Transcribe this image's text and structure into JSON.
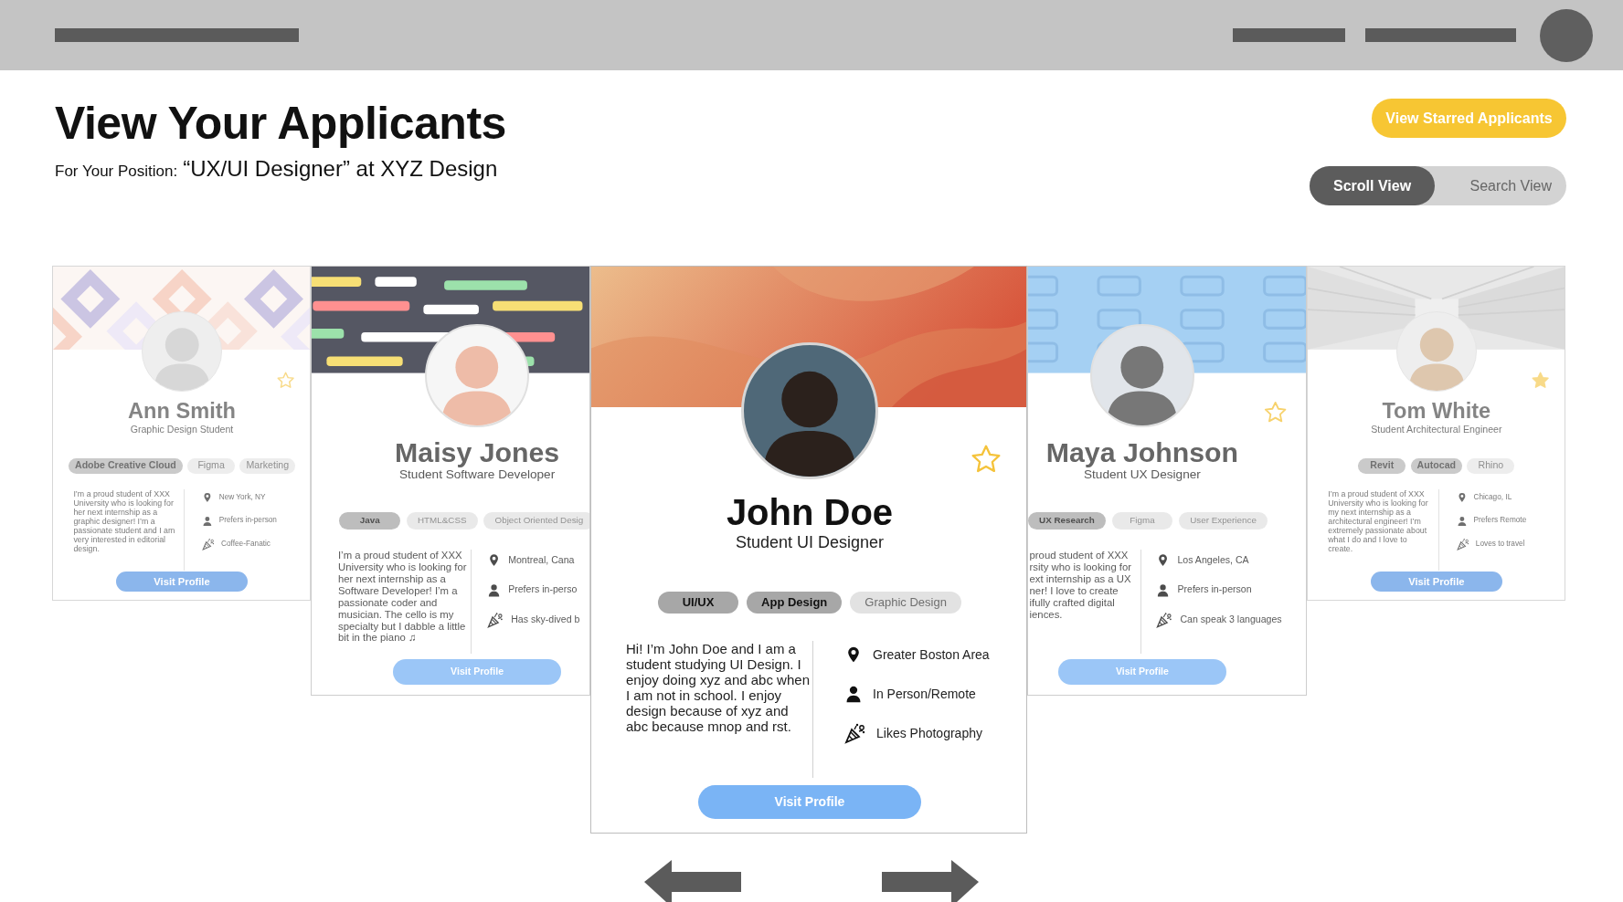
{
  "page": {
    "title": "View Your Applicants",
    "position_label": "For Your Position:",
    "position": "“UX/UI Designer” at XYZ Design"
  },
  "starred_button": "View Starred Applicants",
  "view_toggle": [
    {
      "label": "Scroll View",
      "selected": true
    },
    {
      "label": "Search View",
      "selected": false
    }
  ],
  "cards": [
    {
      "name": "Ann Smith",
      "title": "Graphic Design Student",
      "selected": false,
      "starred": false,
      "tags": [
        {
          "label": "Adobe Creative Cloud",
          "highlighted": true
        },
        {
          "label": "Figma",
          "highlighted": false
        },
        {
          "label": "Marketing",
          "highlighted": false
        }
      ],
      "bio_lines": [
        "I’m a proud student of XXX",
        "University who is looking for",
        "her next internship as a",
        "graphic designer! I’m a",
        "passionate student and I am",
        "very interested in editorial",
        "design."
      ],
      "details": [
        {
          "kind": "location",
          "text": "New York, NY"
        },
        {
          "kind": "work_mode",
          "text": "Prefers in-person"
        },
        {
          "kind": "fun_fact",
          "text": "Coffee-Fanatic"
        }
      ],
      "button": "Visit Profile"
    },
    {
      "name": "Maisy Jones",
      "title": "Student Software Developer",
      "selected": false,
      "tags": [
        {
          "label": "Java",
          "highlighted": true
        },
        {
          "label": "HTML&CSS",
          "highlighted": false
        },
        {
          "label": "Object Oriented Desig",
          "highlighted": false
        }
      ],
      "bio_lines": [
        "I’m a proud student of XXX",
        "University who is looking for",
        "her next internship as a",
        "Software Developer! I’m a",
        "passionate coder and",
        "musician. The cello is my",
        "specialty but I dabble a little",
        "bit in the piano ♫"
      ],
      "details": [
        {
          "kind": "location",
          "text": "Montreal, Cana"
        },
        {
          "kind": "work_mode",
          "text": "Prefers in-perso"
        },
        {
          "kind": "fun_fact",
          "text": "Has sky-dived b"
        }
      ],
      "button": "Visit Profile"
    },
    {
      "name": "John Doe",
      "title": "Student UI Designer",
      "selected": true,
      "starred": false,
      "tags": [
        {
          "label": "UI/UX",
          "highlighted": true
        },
        {
          "label": "App Design",
          "highlighted": true
        },
        {
          "label": "Graphic Design",
          "highlighted": false
        }
      ],
      "bio_lines": [
        "Hi! I’m John Doe and I am a",
        "student studying UI Design. I",
        "enjoy doing xyz and abc when",
        "I am not in school. I enjoy",
        "design because of xyz and",
        "abc because mnop and rst."
      ],
      "details": [
        {
          "kind": "location",
          "text": "Greater Boston Area"
        },
        {
          "kind": "work_mode",
          "text": "In Person/Remote"
        },
        {
          "kind": "fun_fact",
          "text": "Likes Photography"
        }
      ],
      "button": "Visit Profile"
    },
    {
      "name": "Maya Johnson",
      "title": "Student UX Designer",
      "selected": false,
      "starred": false,
      "tags": [
        {
          "label": "UX Research",
          "highlighted": true
        },
        {
          "label": "Figma",
          "highlighted": false
        },
        {
          "label": "User Experience",
          "highlighted": false
        }
      ],
      "bio_lines": [
        "proud student of XXX",
        "rsity who is looking for",
        "ext internship as a UX",
        "ner! I love to create",
        "ifully crafted digital",
        "iences."
      ],
      "details": [
        {
          "kind": "location",
          "text": "Los Angeles, CA"
        },
        {
          "kind": "work_mode",
          "text": "Prefers in-person"
        },
        {
          "kind": "fun_fact",
          "text": "Can speak 3 languages"
        }
      ],
      "button": "Visit Profile"
    },
    {
      "name": "Tom White",
      "title": "Student Architectural Engineer",
      "selected": false,
      "starred": true,
      "tags": [
        {
          "label": "Revit",
          "highlighted": true
        },
        {
          "label": "Autocad",
          "highlighted": true
        },
        {
          "label": "Rhino",
          "highlighted": false
        }
      ],
      "bio_lines": [
        "I’m a proud student of XXX",
        "University who is looking for",
        "my next internship as a",
        "architectural engineer! I’m",
        "extremely passionate about",
        "what I do and I love to",
        "create."
      ],
      "details": [
        {
          "kind": "location",
          "text": "Chicago, IL"
        },
        {
          "kind": "work_mode",
          "text": "Prefers Remote"
        },
        {
          "kind": "fun_fact",
          "text": "Loves to travel"
        }
      ],
      "button": "Visit Profile"
    }
  ]
}
